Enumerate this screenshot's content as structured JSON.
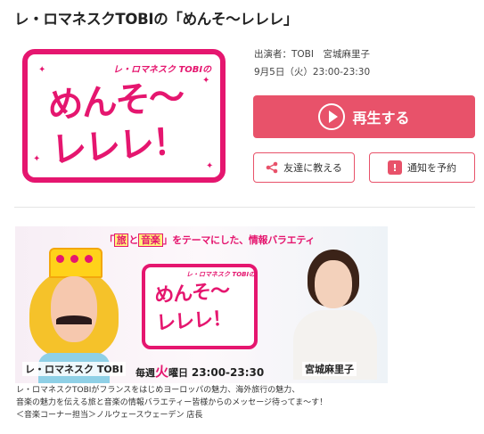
{
  "page": {
    "title": "レ・ロマネスクTOBIの「めんそ～レレレ」"
  },
  "logo": {
    "subtitle": "レ・ロマネスク TOBIの",
    "line1": "めんそ～",
    "line2": "レレレ！",
    "brand_color": "#e5166f"
  },
  "meta": {
    "performers": "出演者：TOBI　宮城麻里子",
    "schedule": "9月5日（火）23:00-23:30"
  },
  "actions": {
    "play_label": "再生する",
    "share_label": "友達に教える",
    "notify_label": "通知を予約",
    "play_color": "#e8526a",
    "icons": {
      "play": "play-circle-icon",
      "share": "share-icon",
      "notify": "bell-alert-icon"
    }
  },
  "banner": {
    "tagline_pre": "「",
    "tagline_w1": "旅",
    "tagline_mid": "と",
    "tagline_w2": "音楽",
    "tagline_post": "」をテーマにした、情報バラエティ",
    "logo_sub": "レ・ロマネスク TOBIの",
    "logo_line1": "めんそ～",
    "logo_line2": "レレレ！",
    "schedule_pre": "毎週",
    "schedule_day": "火",
    "schedule_post": "曜日",
    "schedule_time": "23:00-23:30",
    "host1": "レ・ロマネスク TOBI",
    "host2": "宮城麻里子"
  },
  "description": {
    "line1": "レ・ロマネスクTOBIがフランスをはじめヨーロッパの魅力、海外旅行の魅力、",
    "line2": "音楽の魅力を伝える旅と音楽の情報バラエティー皆様からのメッセージ待ってま～す！",
    "line3": "＜音楽コーナー担当＞ノルウェースウェーデン 店長"
  }
}
